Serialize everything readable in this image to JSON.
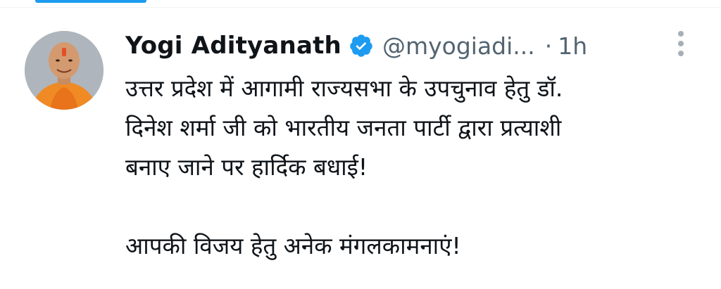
{
  "tweet": {
    "author_name": "Yogi Adityanath",
    "handle": "@myogiadi...",
    "separator": "·",
    "timestamp": "1h",
    "verified": true,
    "avatar_icon": "profile-photo",
    "more_icon": "vertical-ellipsis",
    "text_lines_p1": [
      "उत्तर प्रदेश में आगामी राज्यसभा के उपचुनाव हेतु डॉ.",
      "दिनेश शर्मा जी को भारतीय जनता पार्टी द्वारा प्रत्याशी",
      "बनाए जाने पर हार्दिक बधाई!"
    ],
    "text_line_p2": "आपकी विजय हेतु अनेक मंगलकामनाएं!"
  },
  "colors": {
    "accent": "#1d9bf0",
    "text_primary": "#0f1419",
    "text_secondary": "#536471"
  }
}
